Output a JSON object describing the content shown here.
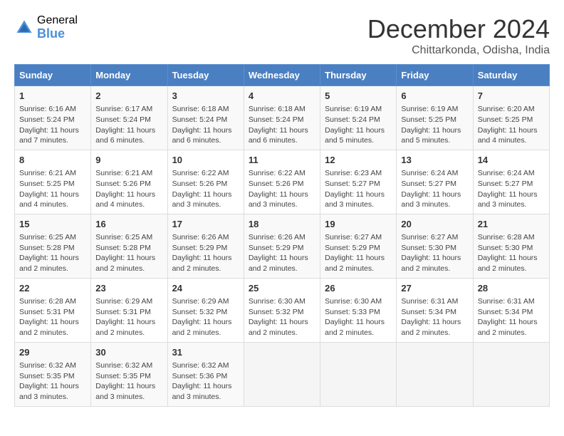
{
  "logo": {
    "general": "General",
    "blue": "Blue"
  },
  "title": {
    "month_year": "December 2024",
    "location": "Chittarkonda, Odisha, India"
  },
  "weekdays": [
    "Sunday",
    "Monday",
    "Tuesday",
    "Wednesday",
    "Thursday",
    "Friday",
    "Saturday"
  ],
  "weeks": [
    [
      {
        "day": "1",
        "info": "Sunrise: 6:16 AM\nSunset: 5:24 PM\nDaylight: 11 hours and 7 minutes."
      },
      {
        "day": "2",
        "info": "Sunrise: 6:17 AM\nSunset: 5:24 PM\nDaylight: 11 hours and 6 minutes."
      },
      {
        "day": "3",
        "info": "Sunrise: 6:18 AM\nSunset: 5:24 PM\nDaylight: 11 hours and 6 minutes."
      },
      {
        "day": "4",
        "info": "Sunrise: 6:18 AM\nSunset: 5:24 PM\nDaylight: 11 hours and 6 minutes."
      },
      {
        "day": "5",
        "info": "Sunrise: 6:19 AM\nSunset: 5:24 PM\nDaylight: 11 hours and 5 minutes."
      },
      {
        "day": "6",
        "info": "Sunrise: 6:19 AM\nSunset: 5:25 PM\nDaylight: 11 hours and 5 minutes."
      },
      {
        "day": "7",
        "info": "Sunrise: 6:20 AM\nSunset: 5:25 PM\nDaylight: 11 hours and 4 minutes."
      }
    ],
    [
      {
        "day": "8",
        "info": "Sunrise: 6:21 AM\nSunset: 5:25 PM\nDaylight: 11 hours and 4 minutes."
      },
      {
        "day": "9",
        "info": "Sunrise: 6:21 AM\nSunset: 5:26 PM\nDaylight: 11 hours and 4 minutes."
      },
      {
        "day": "10",
        "info": "Sunrise: 6:22 AM\nSunset: 5:26 PM\nDaylight: 11 hours and 3 minutes."
      },
      {
        "day": "11",
        "info": "Sunrise: 6:22 AM\nSunset: 5:26 PM\nDaylight: 11 hours and 3 minutes."
      },
      {
        "day": "12",
        "info": "Sunrise: 6:23 AM\nSunset: 5:27 PM\nDaylight: 11 hours and 3 minutes."
      },
      {
        "day": "13",
        "info": "Sunrise: 6:24 AM\nSunset: 5:27 PM\nDaylight: 11 hours and 3 minutes."
      },
      {
        "day": "14",
        "info": "Sunrise: 6:24 AM\nSunset: 5:27 PM\nDaylight: 11 hours and 3 minutes."
      }
    ],
    [
      {
        "day": "15",
        "info": "Sunrise: 6:25 AM\nSunset: 5:28 PM\nDaylight: 11 hours and 2 minutes."
      },
      {
        "day": "16",
        "info": "Sunrise: 6:25 AM\nSunset: 5:28 PM\nDaylight: 11 hours and 2 minutes."
      },
      {
        "day": "17",
        "info": "Sunrise: 6:26 AM\nSunset: 5:29 PM\nDaylight: 11 hours and 2 minutes."
      },
      {
        "day": "18",
        "info": "Sunrise: 6:26 AM\nSunset: 5:29 PM\nDaylight: 11 hours and 2 minutes."
      },
      {
        "day": "19",
        "info": "Sunrise: 6:27 AM\nSunset: 5:29 PM\nDaylight: 11 hours and 2 minutes."
      },
      {
        "day": "20",
        "info": "Sunrise: 6:27 AM\nSunset: 5:30 PM\nDaylight: 11 hours and 2 minutes."
      },
      {
        "day": "21",
        "info": "Sunrise: 6:28 AM\nSunset: 5:30 PM\nDaylight: 11 hours and 2 minutes."
      }
    ],
    [
      {
        "day": "22",
        "info": "Sunrise: 6:28 AM\nSunset: 5:31 PM\nDaylight: 11 hours and 2 minutes."
      },
      {
        "day": "23",
        "info": "Sunrise: 6:29 AM\nSunset: 5:31 PM\nDaylight: 11 hours and 2 minutes."
      },
      {
        "day": "24",
        "info": "Sunrise: 6:29 AM\nSunset: 5:32 PM\nDaylight: 11 hours and 2 minutes."
      },
      {
        "day": "25",
        "info": "Sunrise: 6:30 AM\nSunset: 5:32 PM\nDaylight: 11 hours and 2 minutes."
      },
      {
        "day": "26",
        "info": "Sunrise: 6:30 AM\nSunset: 5:33 PM\nDaylight: 11 hours and 2 minutes."
      },
      {
        "day": "27",
        "info": "Sunrise: 6:31 AM\nSunset: 5:34 PM\nDaylight: 11 hours and 2 minutes."
      },
      {
        "day": "28",
        "info": "Sunrise: 6:31 AM\nSunset: 5:34 PM\nDaylight: 11 hours and 2 minutes."
      }
    ],
    [
      {
        "day": "29",
        "info": "Sunrise: 6:32 AM\nSunset: 5:35 PM\nDaylight: 11 hours and 3 minutes."
      },
      {
        "day": "30",
        "info": "Sunrise: 6:32 AM\nSunset: 5:35 PM\nDaylight: 11 hours and 3 minutes."
      },
      {
        "day": "31",
        "info": "Sunrise: 6:32 AM\nSunset: 5:36 PM\nDaylight: 11 hours and 3 minutes."
      },
      null,
      null,
      null,
      null
    ]
  ]
}
